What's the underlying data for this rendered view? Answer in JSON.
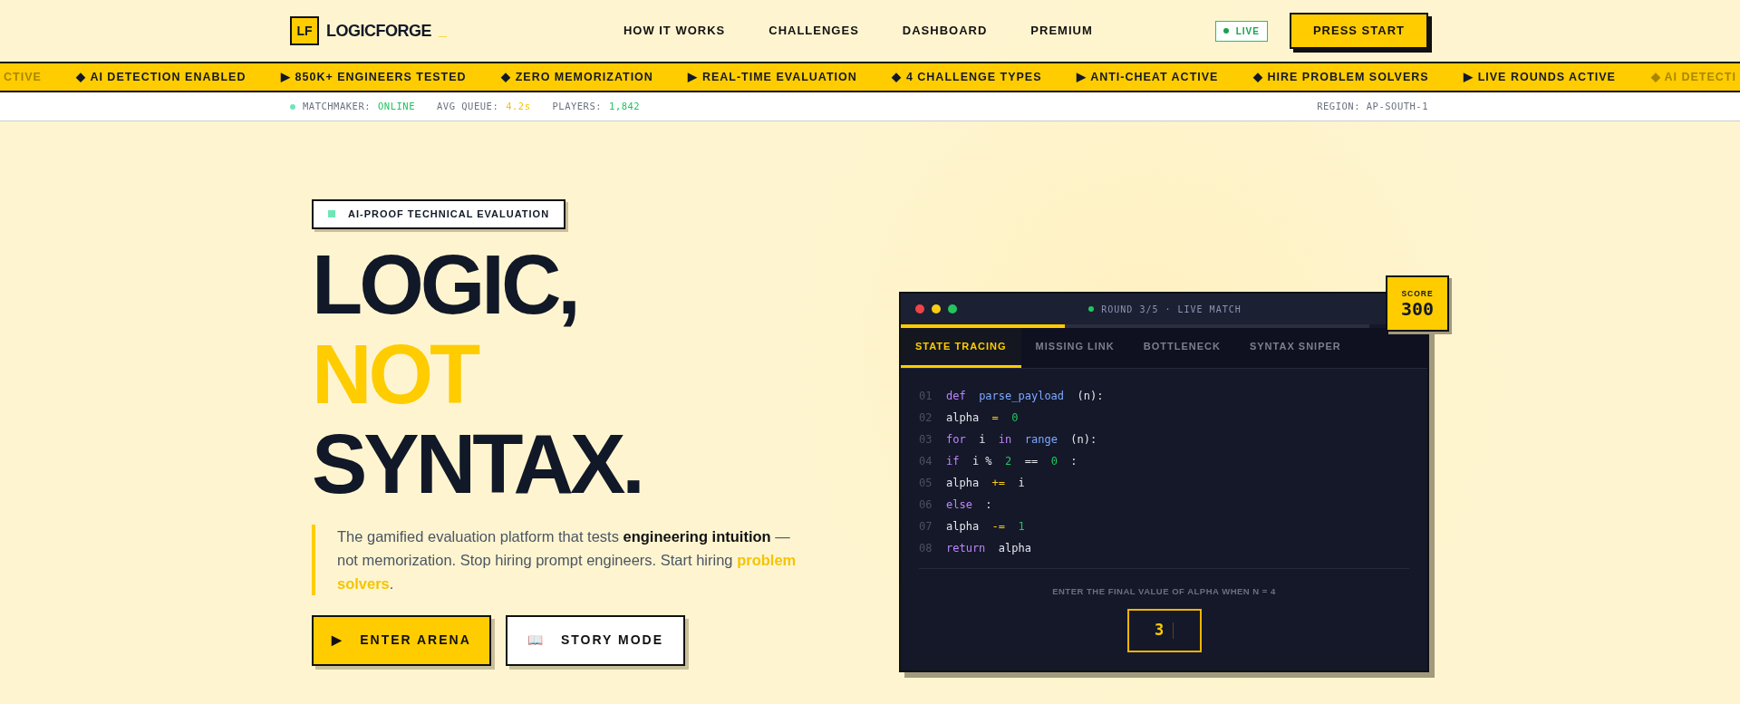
{
  "nav": {
    "logo_mark": "LF",
    "logo_text": "LOGICFORGE",
    "cursor": "_",
    "links": [
      "HOW IT WORKS",
      "CHALLENGES",
      "DASHBOARD",
      "PREMIUM"
    ],
    "live_badge": "LIVE",
    "cta": "PRESS START"
  },
  "ticker": [
    "CTIVE",
    "◆ AI DETECTION ENABLED",
    "▶ 850K+ ENGINEERS TESTED",
    "◆ ZERO MEMORIZATION",
    "▶ REAL-TIME EVALUATION",
    "◆ 4 CHALLENGE TYPES",
    "▶ ANTI-CHEAT ACTIVE",
    "◆ HIRE PROBLEM SOLVERS",
    "▶ LIVE ROUNDS ACTIVE",
    "◆ AI DETECTI"
  ],
  "status_bar": {
    "stats": [
      {
        "label": "MATCHMAKER:",
        "value": "ONLINE",
        "color": "#22c55e"
      },
      {
        "label": "AVG QUEUE:",
        "value": "4.2s",
        "color": "#f5c400"
      },
      {
        "label": "PLAYERS:",
        "value": "1,842",
        "color": "#22c55e"
      }
    ],
    "region": "REGION: AP-SOUTH-1"
  },
  "hero": {
    "badge": "AI-PROOF TECHNICAL EVALUATION",
    "headline": [
      {
        "text": "LOGIC,",
        "accent": false
      },
      {
        "text": "NOT",
        "accent": true
      },
      {
        "text": "SYNTAX.",
        "accent": false
      }
    ],
    "description": "The gamified evaluation platform that tests **engineering intuition** — not memorization. Stop hiring prompt engineers. Start hiring *problem solvers*.",
    "buttons": [
      {
        "kind": "primary",
        "icon": "▶",
        "label": "ENTER ARENA"
      },
      {
        "kind": "secondary",
        "icon": "📖",
        "label": "STORY MODE"
      }
    ]
  },
  "game": {
    "title": "ROUND 3/5 · LIVE MATCH",
    "progress": {
      "level": 0.35
    },
    "score_label": "SCORE",
    "score": "300",
    "tabs": [
      {
        "label": "STATE TRACING",
        "selected": true
      },
      {
        "label": "MISSING LINK",
        "selected": false
      },
      {
        "label": "BOTTLENECK",
        "selected": false
      },
      {
        "label": "SYNTAX SNIPER",
        "selected": false
      }
    ],
    "code": [
      {
        "num": "01",
        "tokens": [
          {
            "kind": "kw",
            "text": "def"
          },
          {
            "kind": "fn",
            "text": "parse_payload"
          },
          {
            "kind": "plain",
            "text": "(n):"
          }
        ]
      },
      {
        "num": "02",
        "tokens": [
          {
            "kind": "plain",
            "text": "alpha"
          },
          {
            "kind": "op",
            "text": "="
          },
          {
            "kind": "num",
            "text": "0"
          }
        ]
      },
      {
        "num": "03",
        "tokens": [
          {
            "kind": "kw",
            "text": "for"
          },
          {
            "kind": "plain",
            "text": "i"
          },
          {
            "kind": "kw",
            "text": "in"
          },
          {
            "kind": "fn",
            "text": "range"
          },
          {
            "kind": "plain",
            "text": "(n):"
          }
        ]
      },
      {
        "num": "04",
        "tokens": [
          {
            "kind": "kw",
            "text": "if"
          },
          {
            "kind": "plain",
            "text": "i %"
          },
          {
            "kind": "num",
            "text": "2"
          },
          {
            "kind": "plain",
            "text": "=="
          },
          {
            "kind": "num",
            "text": "0"
          },
          {
            "kind": "plain",
            "text": ":"
          }
        ]
      },
      {
        "num": "05",
        "tokens": [
          {
            "kind": "plain",
            "text": "alpha"
          },
          {
            "kind": "op",
            "text": "+="
          },
          {
            "kind": "plain",
            "text": "i"
          }
        ]
      },
      {
        "num": "06",
        "tokens": [
          {
            "kind": "kw",
            "text": "else"
          },
          {
            "kind": "plain",
            "text": ":"
          }
        ]
      },
      {
        "num": "07",
        "tokens": [
          {
            "kind": "plain",
            "text": "alpha"
          },
          {
            "kind": "op",
            "text": "-="
          },
          {
            "kind": "num",
            "text": "1"
          }
        ]
      },
      {
        "num": "08",
        "tokens": [
          {
            "kind": "kw",
            "text": "return"
          },
          {
            "kind": "plain",
            "text": "alpha"
          }
        ]
      }
    ],
    "prompt": "ENTER THE FINAL VALUE OF ALPHA WHEN N = 4",
    "answer": "3"
  }
}
